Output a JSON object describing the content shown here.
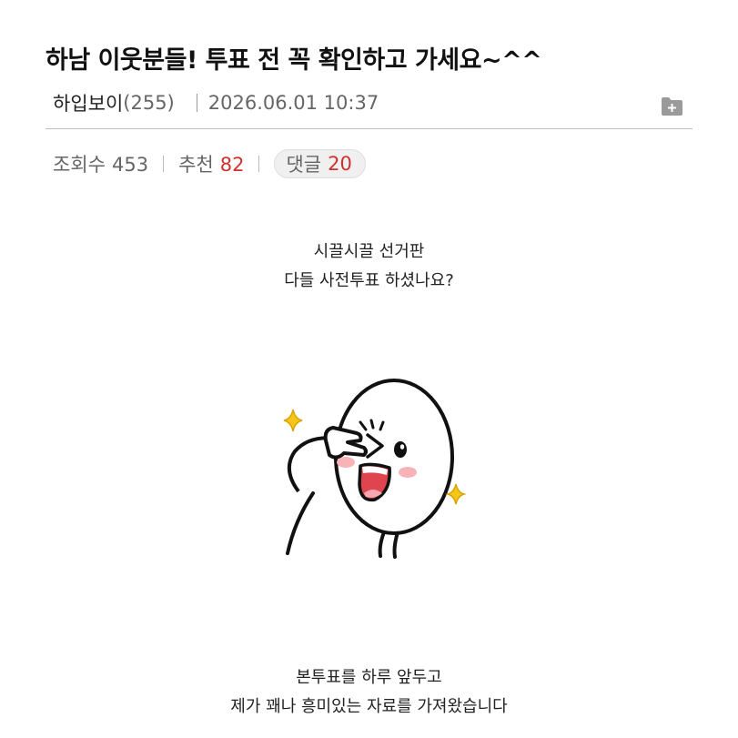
{
  "post": {
    "title": "하남 이웃분들! 투표 전 꼭 확인하고 가세요~^^",
    "author_name": "하입보이",
    "author_level": "(255)",
    "date": "2026.06.01 10:37"
  },
  "stats": {
    "views_label": "조회수",
    "views_value": "453",
    "likes_label": "추천",
    "likes_value": "82",
    "comments_label": "댓글",
    "comments_value": "20"
  },
  "body": {
    "intro_line1": "시끌시끌 선거판",
    "intro_line2": "다들 사전투표 하셨나요?",
    "closing_line1": "본투표를 하루 앞두고",
    "closing_line2": "제가 꽤나 흥미있는 자료를 가져왔습니다"
  },
  "icons": {
    "folder": "folder-add-icon",
    "sticker": "peace-sign-character-sticker"
  },
  "colors": {
    "accent_red": "#d0312d",
    "sparkle_yellow": "#f5c518",
    "mouth_red": "#e0454f",
    "cheek_pink": "#f8b3b8"
  }
}
